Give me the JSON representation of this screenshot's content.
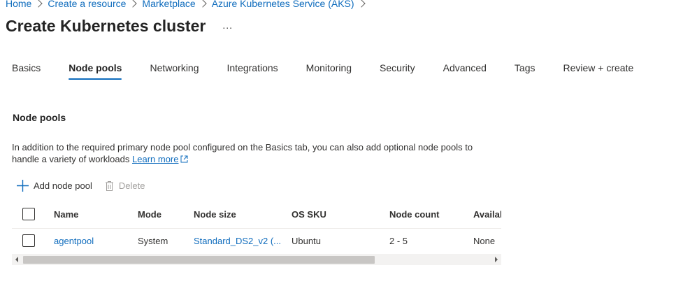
{
  "breadcrumb": {
    "items": [
      "Home",
      "Create a resource",
      "Marketplace",
      "Azure Kubernetes Service (AKS)"
    ]
  },
  "header": {
    "title": "Create Kubernetes cluster",
    "more_label": "..."
  },
  "tabs": [
    {
      "label": "Basics",
      "active": false
    },
    {
      "label": "Node pools",
      "active": true
    },
    {
      "label": "Networking",
      "active": false
    },
    {
      "label": "Integrations",
      "active": false
    },
    {
      "label": "Monitoring",
      "active": false
    },
    {
      "label": "Security",
      "active": false
    },
    {
      "label": "Advanced",
      "active": false
    },
    {
      "label": "Tags",
      "active": false
    },
    {
      "label": "Review + create",
      "active": false
    }
  ],
  "section": {
    "title": "Node pools",
    "description": "In addition to the required primary node pool configured on the Basics tab, you can also add optional node pools to handle a variety of workloads",
    "learn_more": "Learn more"
  },
  "toolbar": {
    "add_label": "Add node pool",
    "add_icon": "plus-icon",
    "delete_label": "Delete",
    "delete_icon": "trash-icon",
    "delete_disabled": true
  },
  "table": {
    "columns": [
      "Name",
      "Mode",
      "Node size",
      "OS SKU",
      "Node count",
      "Availab"
    ],
    "rows": [
      {
        "name": "agentpool",
        "mode": "System",
        "node_size": "Standard_DS2_v2 (...",
        "os_sku": "Ubuntu",
        "node_count": "2 - 5",
        "availability": "None"
      }
    ]
  },
  "colors": {
    "accent": "#0f6cbd",
    "text": "#323130",
    "disabled": "#a19f9d"
  }
}
